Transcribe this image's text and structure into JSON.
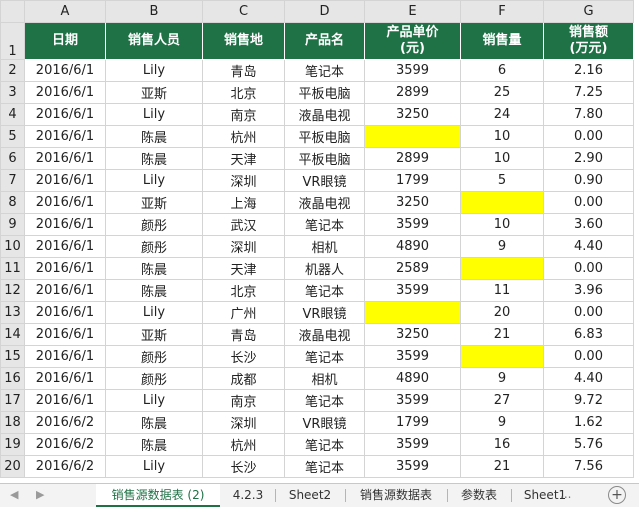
{
  "columns": [
    "A",
    "B",
    "C",
    "D",
    "E",
    "F",
    "G"
  ],
  "header": [
    "日期",
    "销售人员",
    "销售地",
    "产品名",
    "产品单价\n(元)",
    "销售量",
    "销售额\n(万元)"
  ],
  "rows": [
    {
      "n": "2",
      "c": [
        "2016/6/1",
        "Lily",
        "青岛",
        "笔记本",
        "3599",
        "6",
        "2.16"
      ]
    },
    {
      "n": "3",
      "c": [
        "2016/6/1",
        "亚斯",
        "北京",
        "平板电脑",
        "2899",
        "25",
        "7.25"
      ]
    },
    {
      "n": "4",
      "c": [
        "2016/6/1",
        "Lily",
        "南京",
        "液晶电视",
        "3250",
        "24",
        "7.80"
      ]
    },
    {
      "n": "5",
      "c": [
        "2016/6/1",
        "陈晨",
        "杭州",
        "平板电脑",
        "",
        "10",
        "0.00"
      ],
      "y": [
        4
      ]
    },
    {
      "n": "6",
      "c": [
        "2016/6/1",
        "陈晨",
        "天津",
        "平板电脑",
        "2899",
        "10",
        "2.90"
      ]
    },
    {
      "n": "7",
      "c": [
        "2016/6/1",
        "Lily",
        "深圳",
        "VR眼镜",
        "1799",
        "5",
        "0.90"
      ]
    },
    {
      "n": "8",
      "c": [
        "2016/6/1",
        "亚斯",
        "上海",
        "液晶电视",
        "3250",
        "",
        "0.00"
      ],
      "y": [
        5
      ]
    },
    {
      "n": "9",
      "c": [
        "2016/6/1",
        "颜彤",
        "武汉",
        "笔记本",
        "3599",
        "10",
        "3.60"
      ]
    },
    {
      "n": "10",
      "c": [
        "2016/6/1",
        "颜彤",
        "深圳",
        "相机",
        "4890",
        "9",
        "4.40"
      ]
    },
    {
      "n": "11",
      "c": [
        "2016/6/1",
        "陈晨",
        "天津",
        "机器人",
        "2589",
        "",
        "0.00"
      ],
      "y": [
        5
      ]
    },
    {
      "n": "12",
      "c": [
        "2016/6/1",
        "陈晨",
        "北京",
        "笔记本",
        "3599",
        "11",
        "3.96"
      ]
    },
    {
      "n": "13",
      "c": [
        "2016/6/1",
        "Lily",
        "广州",
        "VR眼镜",
        "",
        "20",
        "0.00"
      ],
      "y": [
        4
      ]
    },
    {
      "n": "14",
      "c": [
        "2016/6/1",
        "亚斯",
        "青岛",
        "液晶电视",
        "3250",
        "21",
        "6.83"
      ]
    },
    {
      "n": "15",
      "c": [
        "2016/6/1",
        "颜彤",
        "长沙",
        "笔记本",
        "3599",
        "",
        "0.00"
      ],
      "y": [
        5
      ]
    },
    {
      "n": "16",
      "c": [
        "2016/6/1",
        "颜彤",
        "成都",
        "相机",
        "4890",
        "9",
        "4.40"
      ]
    },
    {
      "n": "17",
      "c": [
        "2016/6/1",
        "Lily",
        "南京",
        "笔记本",
        "3599",
        "27",
        "9.72"
      ]
    },
    {
      "n": "18",
      "c": [
        "2016/6/2",
        "陈晨",
        "深圳",
        "VR眼镜",
        "1799",
        "9",
        "1.62"
      ]
    },
    {
      "n": "19",
      "c": [
        "2016/6/2",
        "陈晨",
        "杭州",
        "笔记本",
        "3599",
        "16",
        "5.76"
      ]
    },
    {
      "n": "20",
      "c": [
        "2016/6/2",
        "Lily",
        "长沙",
        "笔记本",
        "3599",
        "21",
        "7.56"
      ]
    }
  ],
  "tabs": [
    "销售源数据表 (2)",
    "4.2.3",
    "Sheet2",
    "销售源数据表",
    "参数表",
    "Sheet1"
  ],
  "active_tab": 0,
  "tabbar": {
    "prev": "◀",
    "next": "▶",
    "more": "...",
    "add": "+"
  },
  "colors": {
    "header_bg": "#1f7146",
    "highlight": "#ffff00",
    "active_tab": "#1f7146"
  }
}
